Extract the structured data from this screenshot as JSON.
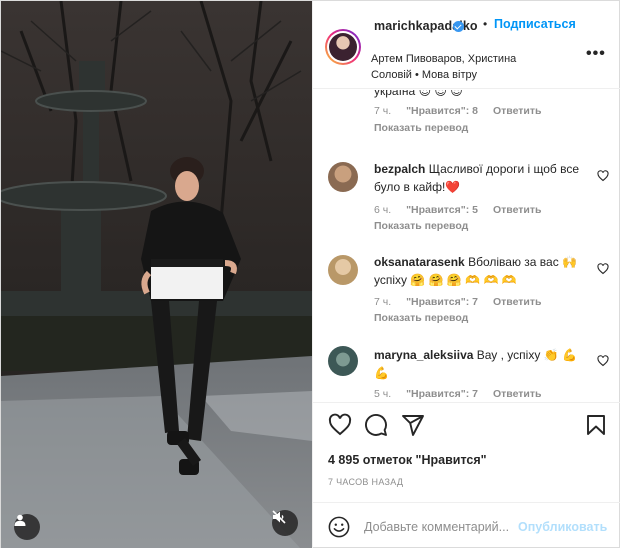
{
  "post": {
    "username": "marichkapadalko",
    "separator": "•",
    "follow_label": "Подписаться",
    "audio": "Артем Пивоваров, Христина Соловій • Мова вітру",
    "more_icon": "more-horizontal-icon"
  },
  "comments": [
    {
      "text": "україна 😍 😍 😍",
      "time": "7 ч.",
      "likes": "\"Нравится\": 8",
      "reply": "Ответить",
      "translate": "Показать перевод"
    },
    {
      "username": "bezpalch",
      "text": "Щасливої дороги і щоб все було в кайф!❤️",
      "time": "6 ч.",
      "likes": "\"Нравится\": 5",
      "reply": "Ответить",
      "translate": "Показать перевод"
    },
    {
      "username": "oksanatarasenk",
      "text": "Вболіваю за вас 🙌 успіху 🤗 🤗 🤗 🫶 🫶 🫶",
      "time": "7 ч.",
      "likes": "\"Нравится\": 7",
      "reply": "Ответить",
      "translate": "Показать перевод"
    },
    {
      "username": "maryna_aleksiiva",
      "text": "Вау , успіху 👏 💪 💪",
      "time": "5 ч.",
      "likes": "\"Нравится\": 7",
      "reply": "Ответить"
    }
  ],
  "actions": {
    "like_icon": "heart-icon",
    "comment_icon": "comment-icon",
    "share_icon": "paper-plane-icon",
    "save_icon": "bookmark-icon"
  },
  "likes_count": "4 895 отметок \"Нравится\"",
  "time_ago": "7 ЧАСОВ НАЗАД",
  "add_comment": {
    "placeholder": "Добавьте комментарий...",
    "publish_label": "Опубликовать"
  },
  "colors": {
    "link_blue": "#0095f6",
    "publish_disabled": "#b2dffc",
    "muted": "#8e8e8e",
    "like_red": "#ed4956"
  }
}
